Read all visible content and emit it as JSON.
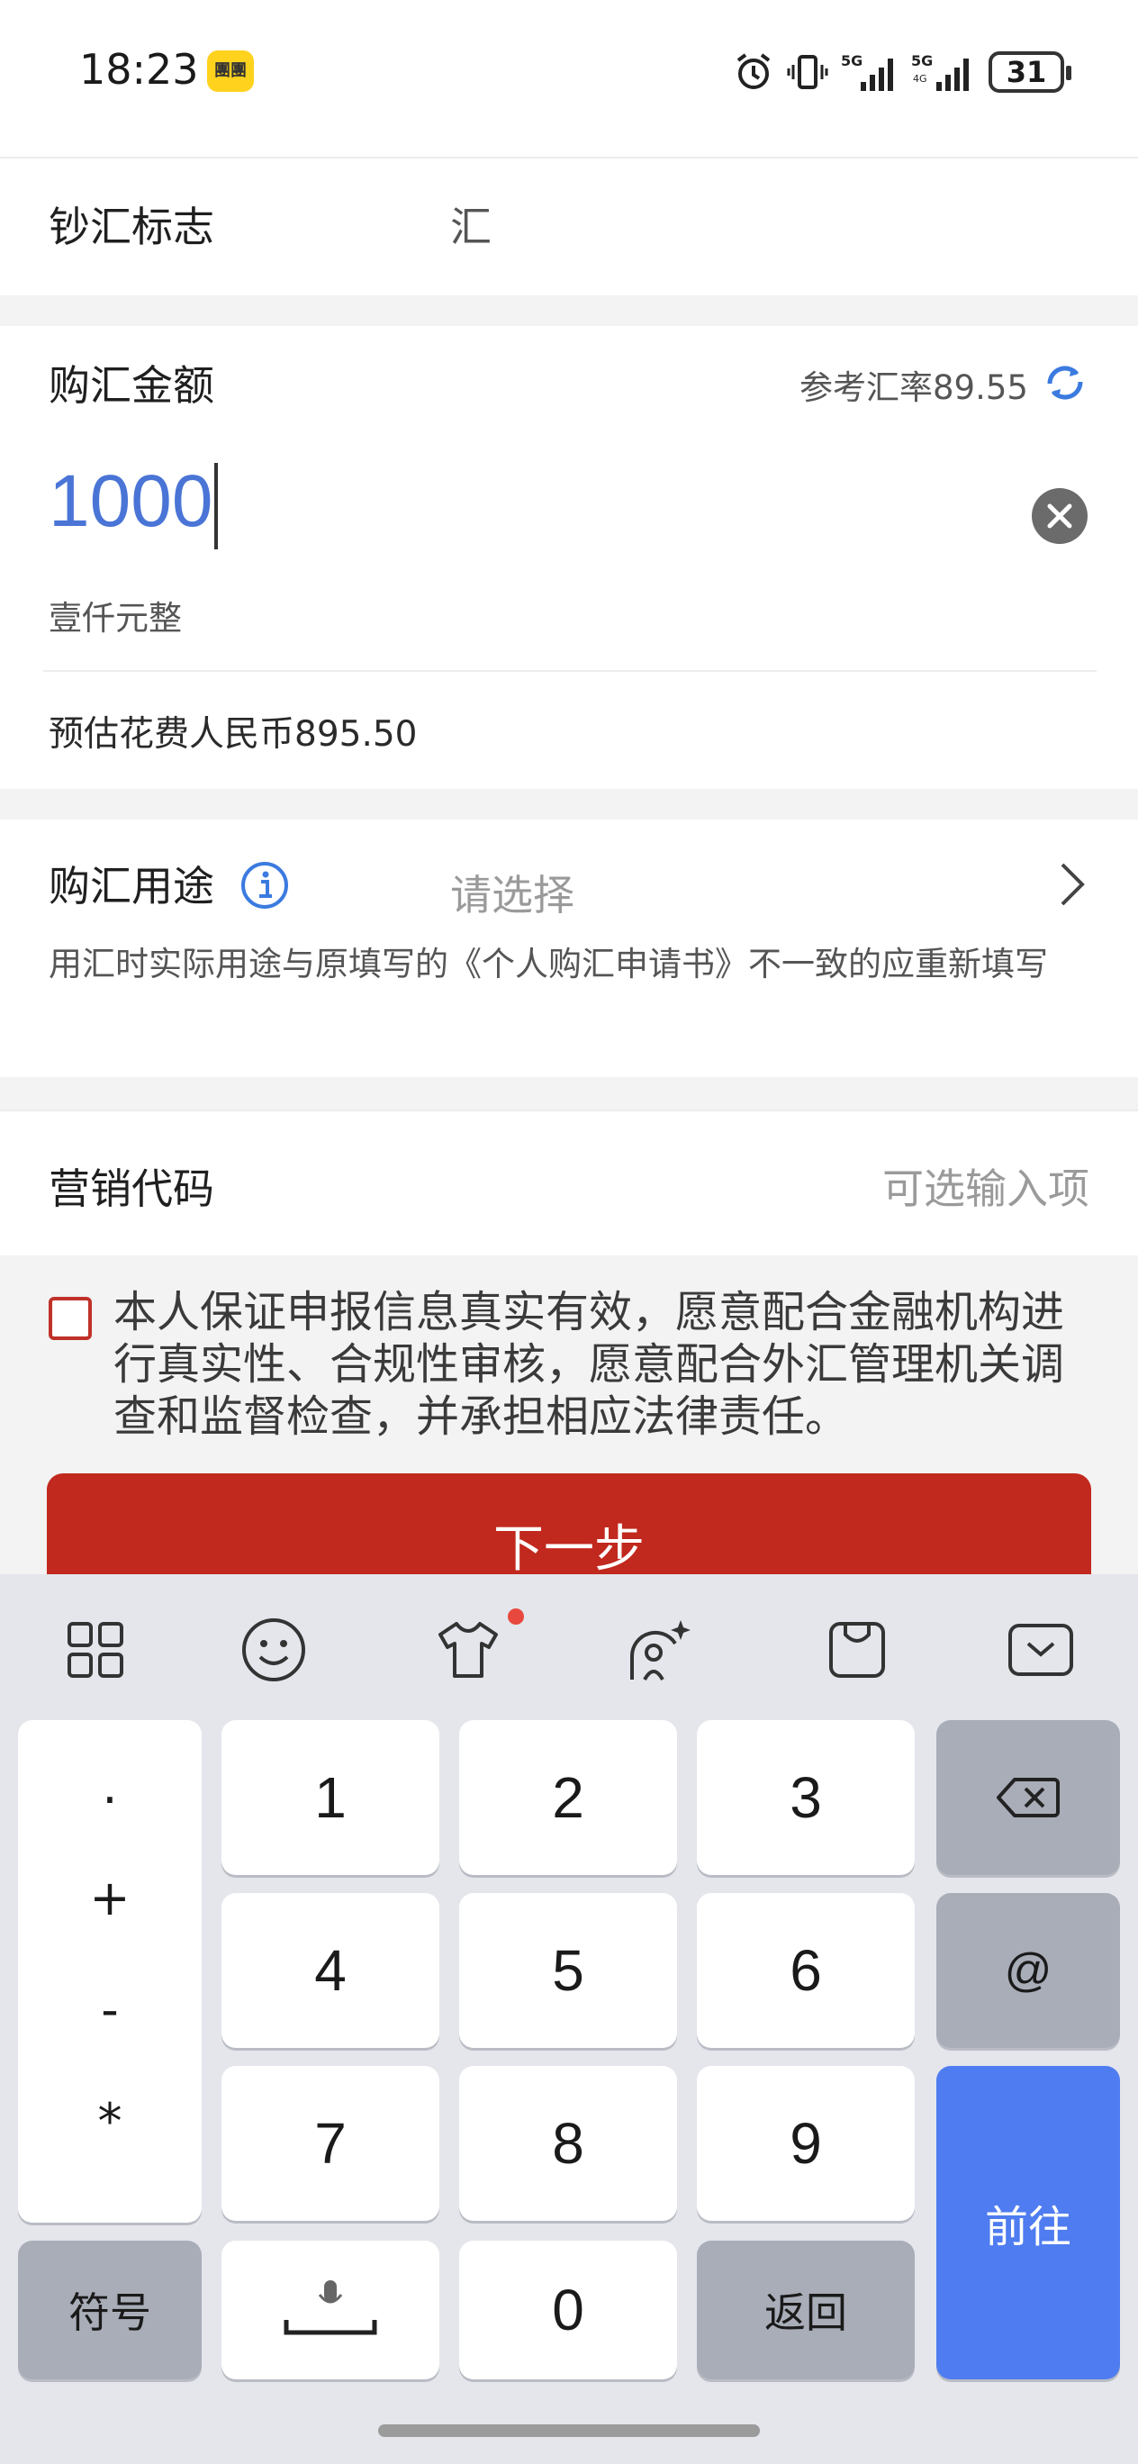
{
  "status_bar": {
    "time": "18:23",
    "app_badge": "團團",
    "battery": "31",
    "icons": [
      "alarm-icon",
      "vibrate-icon",
      "signal-5g-icon",
      "signal-5g-icon-2",
      "battery-icon"
    ]
  },
  "form": {
    "cash_flag": {
      "label": "钞汇标志",
      "value": "汇"
    },
    "amount": {
      "label": "购汇金额",
      "rate_text": "参考汇率89.55",
      "input_value": "1000",
      "uppercase_amount": "壹仟元整",
      "estimate_text": "预估花费人民币895.50"
    },
    "purpose": {
      "label": "购汇用途",
      "placeholder": "请选择",
      "note": "用汇时实际用途与原填写的《个人购汇申请书》不一致的应重新填写"
    },
    "marketing": {
      "label": "营销代码",
      "placeholder": "可选输入项"
    },
    "declaration": "本人保证申报信息真实有效，愿意配合金融机构进行真实性、合规性审核，愿意配合外汇管理机关调查和监督检查，并承担相应法律责任。",
    "next_button": "下一步"
  },
  "keyboard": {
    "symbols": [
      ".",
      "+",
      "-",
      "*"
    ],
    "digits": [
      "1",
      "2",
      "3",
      "4",
      "5",
      "6",
      "7",
      "8",
      "9",
      "0"
    ],
    "at_key": "@",
    "symbol_key": "符号",
    "back_key": "返回",
    "go_key": "前往",
    "toolbar_icons": [
      "grid-icon",
      "emoji-icon",
      "skin-icon",
      "ai-icon",
      "clipboard-icon",
      "collapse-keyboard-icon"
    ]
  },
  "colors": {
    "brand_red": "#c1281e",
    "input_blue": "#4a75d6",
    "go_key_blue": "#4f7cf0"
  }
}
